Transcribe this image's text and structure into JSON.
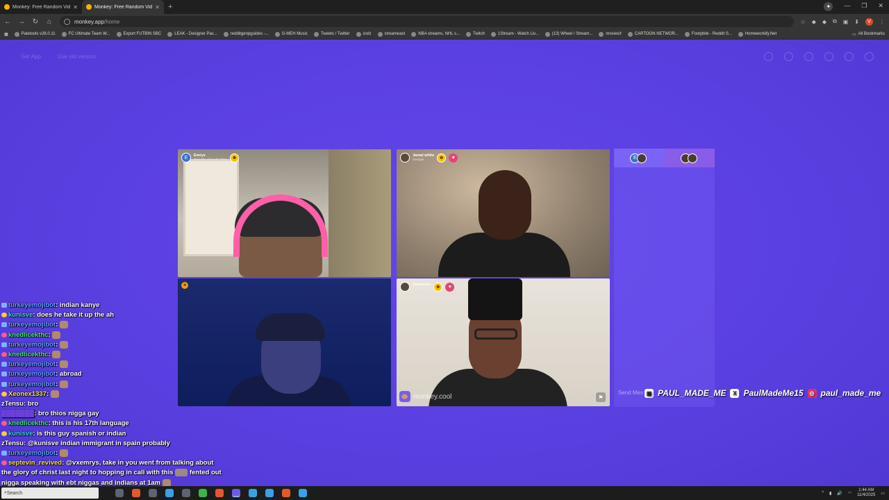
{
  "browser": {
    "tabs": [
      {
        "title": "Monkey: Free Random Video C",
        "active": false
      },
      {
        "title": "Monkey: Free Random Vid",
        "active": true
      }
    ],
    "url_host": "monkey.app",
    "url_path": "/home",
    "bookmarks": [
      "Paletools v26.0.11",
      "FC Ultimate Team W...",
      "Export FUTBIN SBC",
      "LEAK - Designer Pac...",
      "redditgenpguides -...",
      "G-MEH Music",
      "Tweets / Twitter",
      "icolz",
      "streameast",
      "NBA streams, NHL s...",
      "Twitch",
      "1Stream - Watch Liv...",
      "(13) Wheel / Stream...",
      "movies/t",
      "CARTOON NETWOR...",
      "Footybite - Reddit S...",
      "Homeworkify.Net"
    ],
    "all_bookmarks": "All Bookmarks",
    "profile_initial": "V"
  },
  "page": {
    "get_app": "Get App",
    "use_old_version": "Use old version",
    "send_message_placeholder": "Send Mes"
  },
  "participants": [
    {
      "name": "Emrys",
      "location": "Republic of South Africa",
      "initial": "E"
    },
    {
      "name": "Jamal white",
      "location": "Georgia"
    },
    {
      "name": "",
      "location": ""
    },
    {
      "name": "Demarkes",
      "location": "Georgia"
    }
  ],
  "watermark": "monkey.cool",
  "side_panel": {
    "tab_a_initial": "E"
  },
  "socials": {
    "twitch": "PAUL_MADE_ME",
    "x": "PaulMadeMe15",
    "instagram": "paul_made_me"
  },
  "chat": [
    {
      "user": "turkeyemojibot",
      "msg": "indian kanye",
      "cls": "u-turk",
      "icon": "ic"
    },
    {
      "user": "kunisve",
      "msg": "does he take it up the ah",
      "cls": "u-kun",
      "icon": "ic m"
    },
    {
      "user": "turkeyemojibot",
      "msg": "",
      "cls": "u-turk",
      "icon": "ic",
      "emote": true
    },
    {
      "user": "knedlicekthc",
      "msg": "",
      "cls": "u-kned",
      "icon": "ic h",
      "emote": true
    },
    {
      "user": "turkeyemojibot",
      "msg": "",
      "cls": "u-turk",
      "icon": "ic",
      "emote": true
    },
    {
      "user": "knedlicekthc",
      "msg": "",
      "cls": "u-kned",
      "icon": "ic h",
      "emote": true
    },
    {
      "user": "turkeyemojibot",
      "msg": "",
      "cls": "u-turk",
      "icon": "ic",
      "emote": true
    },
    {
      "user": "turkeyemojibot",
      "msg": "abroad",
      "cls": "u-turk",
      "icon": "ic"
    },
    {
      "user": "turkeyemojibot",
      "msg": "",
      "cls": "u-turk",
      "icon": "ic",
      "emote": true
    },
    {
      "user": "Xeonex1337",
      "msg": "",
      "cls": "u-xeo",
      "icon": "ic m",
      "emote": true
    },
    {
      "user": "zTensu",
      "msg": "bro",
      "cls": "u-zten",
      "icon": ""
    },
    {
      "user": "",
      "msg": "bro thios nigga gay",
      "cls": "u-hid",
      "icon": ""
    },
    {
      "user": "knedlicekthc",
      "msg": "this is his 17th language",
      "cls": "u-kned",
      "icon": "ic h"
    },
    {
      "user": "kunisve",
      "msg": "is this guy spanish or indian",
      "cls": "u-kun",
      "icon": "ic m"
    },
    {
      "user": "zTensu",
      "msg": "@kunisve indian immigrant in spain probably",
      "cls": "u-zten",
      "icon": ""
    },
    {
      "user": "turkeyemojibot",
      "msg": "",
      "cls": "u-turk",
      "icon": "ic",
      "emote": true
    },
    {
      "user": "septevin_revived",
      "msg": "@vxemrys, take in you went from talking about",
      "cls": "u-sept",
      "icon": "ic h"
    },
    {
      "user": "",
      "msg": "the glory of christ last night to hopping in call with this",
      "cls": "u-zten",
      "icon": "",
      "tail": "fented out",
      "wide": true
    },
    {
      "user": "",
      "msg": "nigga speaking with ebt niggas and indians at 1am",
      "cls": "u-zten",
      "icon": "",
      "emote": true
    }
  ],
  "taskbar": {
    "search_text": "Search",
    "time": "1:44 AM",
    "date": "11/4/2025"
  }
}
